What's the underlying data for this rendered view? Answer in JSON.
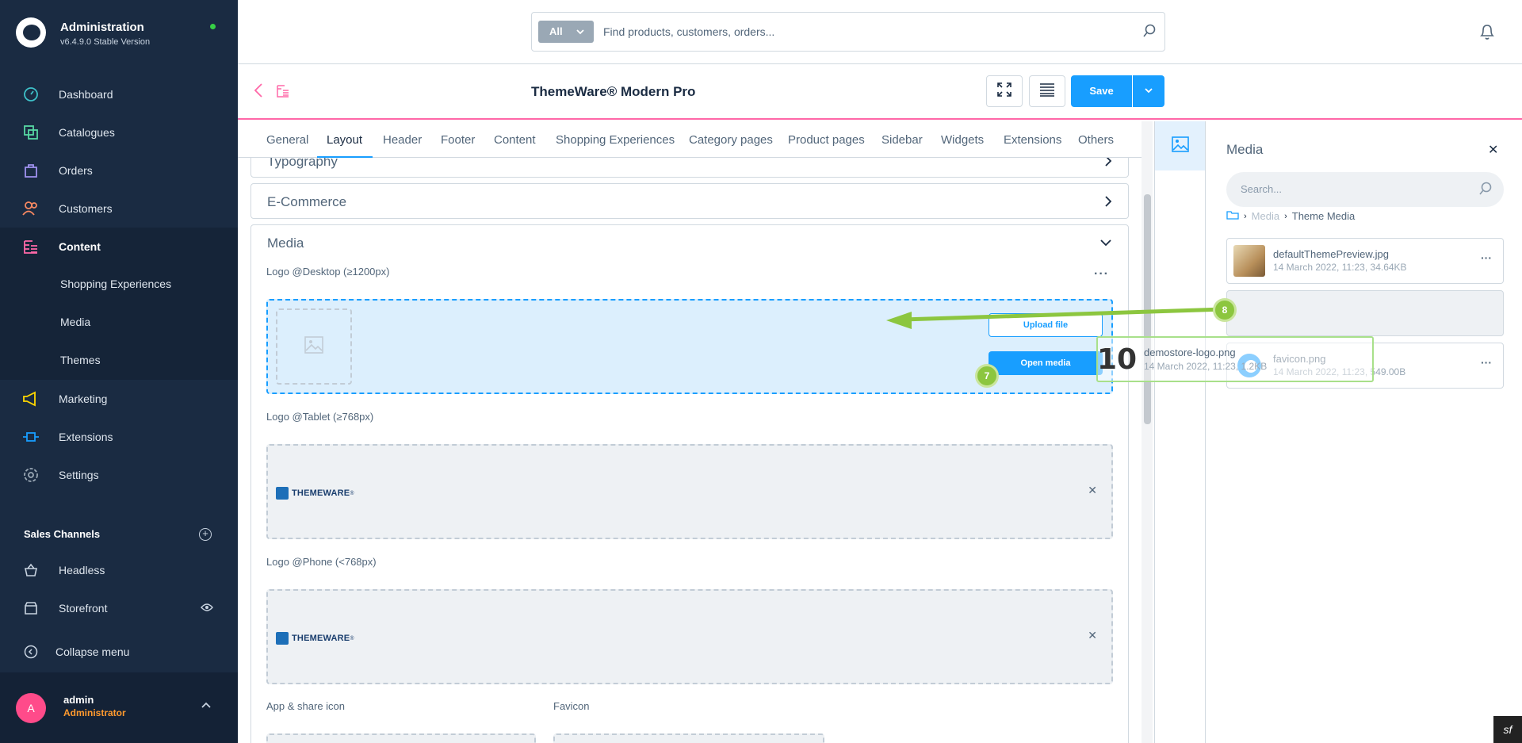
{
  "app": {
    "name": "Administration",
    "version": "v6.4.9.0 Stable Version"
  },
  "nav": {
    "items": [
      {
        "label": "Dashboard",
        "icon": "dashboard-icon"
      },
      {
        "label": "Catalogues",
        "icon": "catalogues-icon"
      },
      {
        "label": "Orders",
        "icon": "orders-icon"
      },
      {
        "label": "Customers",
        "icon": "customers-icon"
      },
      {
        "label": "Content",
        "icon": "content-icon"
      },
      {
        "label": "Marketing",
        "icon": "marketing-icon"
      },
      {
        "label": "Extensions",
        "icon": "extensions-icon"
      },
      {
        "label": "Settings",
        "icon": "settings-icon"
      }
    ],
    "content_sub": [
      "Shopping Experiences",
      "Media",
      "Themes"
    ],
    "sales_channels_title": "Sales Channels",
    "sales_channels": [
      "Headless",
      "Storefront"
    ],
    "collapse_label": "Collapse menu"
  },
  "user": {
    "initial": "A",
    "name": "admin",
    "role": "Administrator"
  },
  "search": {
    "type": "All",
    "placeholder": "Find products, customers, orders..."
  },
  "smartbar": {
    "title": "ThemeWare® Modern Pro",
    "save_label": "Save"
  },
  "tabs": [
    "General",
    "Layout",
    "Header",
    "Footer",
    "Content",
    "Shopping Experiences",
    "Category pages",
    "Product pages",
    "Sidebar",
    "Widgets",
    "Extensions",
    "Others"
  ],
  "active_tab": "Layout",
  "cards": {
    "typography": "Typography",
    "ecommerce": "E-Commerce",
    "media": "Media"
  },
  "media_fields": {
    "logo_desktop": "Logo @Desktop (≥1200px)",
    "logo_tablet": "Logo @Tablet (≥768px)",
    "logo_phone": "Logo @Phone (<768px)",
    "app_icon": "App & share icon",
    "favicon": "Favicon",
    "upload_label": "Upload file",
    "open_media_label": "Open media",
    "logo_text": "THEMEWARE",
    "logo_reg": "®"
  },
  "media_panel": {
    "title": "Media",
    "search_placeholder": "Search...",
    "breadcrumb_root": "Media",
    "breadcrumb_current": "Theme Media",
    "items": [
      {
        "name": "defaultThemePreview.jpg",
        "meta": "14 March 2022, 11:23, 34.64KB"
      },
      {
        "name": "",
        "meta": ""
      },
      {
        "name": "favicon.png",
        "meta": "14 March 2022, 11:23, 549.00B"
      }
    ]
  },
  "drag": {
    "ghost_glyph": "10",
    "name": "demostore-logo.png",
    "meta": "14 March 2022, 11:23, 1.2KB",
    "step_a": "7",
    "step_b": "8"
  },
  "colors": {
    "sidebar_bg": "#1a2b42",
    "accent": "#189eff",
    "pink": "#ff68a8",
    "arrow_green": "#8cc63f"
  }
}
